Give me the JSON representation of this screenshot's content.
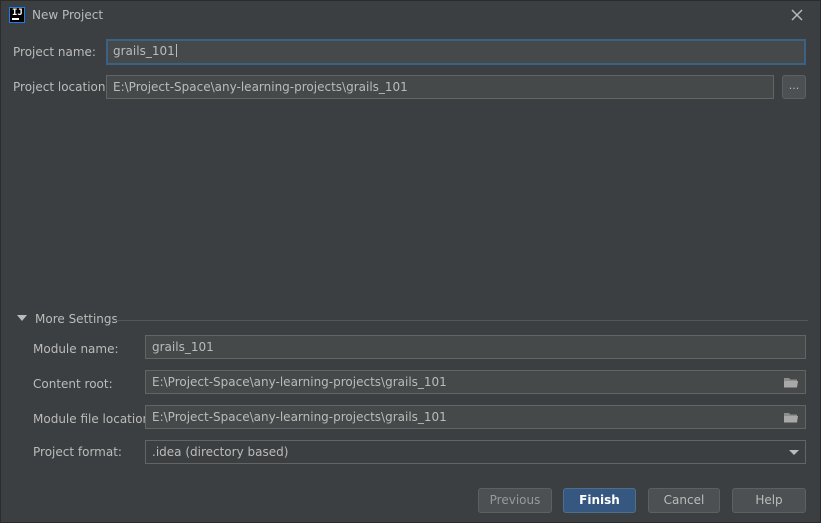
{
  "window": {
    "title": "New Project",
    "app_icon_text": "IJ"
  },
  "project": {
    "name_label": "Project name:",
    "name_value": "grails_101",
    "location_label": "Project location:",
    "location_value": "E:\\Project-Space\\any-learning-projects\\grails_101",
    "browse_label": "..."
  },
  "more_settings": {
    "label": "More Settings",
    "expanded": true,
    "module_name_label": "Module name:",
    "module_name_value": "grails_101",
    "content_root_label": "Content root:",
    "content_root_value": "E:\\Project-Space\\any-learning-projects\\grails_101",
    "module_file_location_label": "Module file location:",
    "module_file_location_value": "E:\\Project-Space\\any-learning-projects\\grails_101",
    "project_format_label": "Project format:",
    "project_format_value": ".idea (directory based)"
  },
  "buttons": {
    "previous": "Previous",
    "finish": "Finish",
    "cancel": "Cancel",
    "help": "Help"
  },
  "colors": {
    "background": "#3c3f41",
    "field_background": "#45494a",
    "focus_border": "#3d6185",
    "default_button": "#365880",
    "text": "#bbbbbb"
  },
  "icons": {
    "app": "intellij-idea-icon",
    "close": "close-icon",
    "folder": "folder-icon",
    "expand": "triangle-down-icon",
    "dropdown": "chevron-down-icon"
  }
}
